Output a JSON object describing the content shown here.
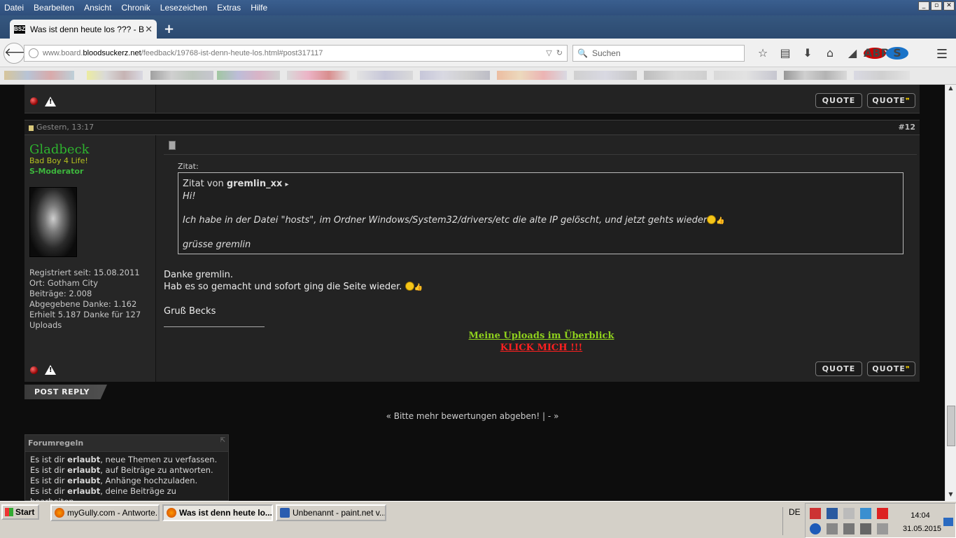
{
  "menubar": {
    "items": [
      "Datei",
      "Bearbeiten",
      "Ansicht",
      "Chronik",
      "Lesezeichen",
      "Extras",
      "Hilfe"
    ]
  },
  "tab": {
    "favicon": "BSZ",
    "title": "Was ist denn heute los ??? - B..."
  },
  "url": {
    "prefix": "www.board.",
    "domain": "bloodsuckerz.net",
    "path": "/feedback/19768-ist-denn-heute-los.html#post317117"
  },
  "search": {
    "placeholder": "Suchen"
  },
  "quote_label": "QUOTE",
  "post": {
    "date": "Gestern, 13:17",
    "number": "#12",
    "username": "Gladbeck",
    "user_title": "Bad Boy 4 Life!",
    "user_rank": "S-Moderator",
    "info": [
      "Registriert seit: 15.08.2011",
      "Ort: Gotham City",
      "Beiträge: 2.008",
      "Abgegebene Danke: 1.162",
      "Erhielt 5.187 Danke für 127 Uploads"
    ],
    "quote_label": "Zitat:",
    "quote_prefix": "Zitat von ",
    "quote_author": "gremlin_xx",
    "quote_lines": [
      "Hi!",
      "Ich habe in der Datei \"hosts\", im Ordner Windows/System32/drivers/etc die alte IP gelöscht, und jetzt gehts wieder",
      "grüsse gremlin"
    ],
    "message": [
      "Danke gremlin.",
      "Hab es so gemacht und sofort ging die Seite wieder.",
      "Gruß Becks"
    ],
    "sig_link1": "Meine Uploads im Überblick",
    "sig_link2": "KLICK MICH !!!"
  },
  "post_reply": "POST REPLY",
  "threadnav": {
    "prev": "« Bitte mehr bewertungen abgeben!",
    "sep": "|",
    "dash": "-",
    "next": "»"
  },
  "rules": {
    "title": "Forumregeln",
    "prefix": "Es ist dir ",
    "bold": "erlaubt",
    "items": [
      ", neue Themen zu verfassen.",
      ", auf Beiträge zu antworten.",
      ", Anhänge hochzuladen.",
      ", deine Beiträge zu bearbeiten."
    ]
  },
  "taskbar": {
    "start": "Start",
    "tasks": [
      "myGully.com - Antworte...",
      "Was ist denn heute lo...",
      "Unbenannt - paint.net v..."
    ],
    "lang": "DE",
    "time": "14:04",
    "date": "31.05.2015"
  }
}
